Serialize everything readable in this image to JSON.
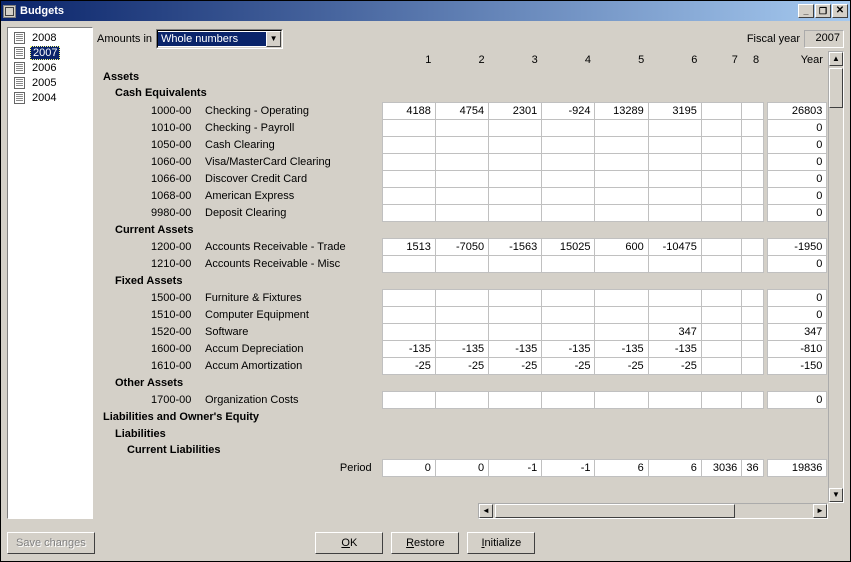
{
  "window": {
    "title": "Budgets"
  },
  "sidebar": {
    "years": [
      {
        "label": "2008",
        "selected": false
      },
      {
        "label": "2007",
        "selected": true
      },
      {
        "label": "2006",
        "selected": false
      },
      {
        "label": "2005",
        "selected": false
      },
      {
        "label": "2004",
        "selected": false
      }
    ]
  },
  "toolbar": {
    "amounts_label": "Amounts in",
    "amounts_value": "Whole numbers",
    "fiscal_year_label": "Fiscal year",
    "fiscal_year_value": "2007"
  },
  "columns": {
    "nums": [
      "1",
      "2",
      "3",
      "4",
      "5",
      "6",
      "7",
      "8"
    ],
    "year_label": "Year"
  },
  "sections": [
    {
      "heading": "Assets",
      "level": 0,
      "groups": [
        {
          "heading": "Cash Equivalents",
          "level": 1,
          "rows": [
            {
              "code": "1000-00",
              "name": "Checking - Operating",
              "vals": [
                "4188",
                "4754",
                "2301",
                "-924",
                "13289",
                "3195",
                "",
                ""
              ],
              "year": "26803"
            },
            {
              "code": "1010-00",
              "name": "Checking - Payroll",
              "vals": [
                "",
                "",
                "",
                "",
                "",
                "",
                "",
                ""
              ],
              "year": "0"
            },
            {
              "code": "1050-00",
              "name": "Cash Clearing",
              "vals": [
                "",
                "",
                "",
                "",
                "",
                "",
                "",
                ""
              ],
              "year": "0"
            },
            {
              "code": "1060-00",
              "name": "Visa/MasterCard Clearing",
              "vals": [
                "",
                "",
                "",
                "",
                "",
                "",
                "",
                ""
              ],
              "year": "0"
            },
            {
              "code": "1066-00",
              "name": "Discover Credit Card",
              "vals": [
                "",
                "",
                "",
                "",
                "",
                "",
                "",
                ""
              ],
              "year": "0"
            },
            {
              "code": "1068-00",
              "name": "American Express",
              "vals": [
                "",
                "",
                "",
                "",
                "",
                "",
                "",
                ""
              ],
              "year": "0"
            },
            {
              "code": "9980-00",
              "name": "Deposit Clearing",
              "vals": [
                "",
                "",
                "",
                "",
                "",
                "",
                "",
                ""
              ],
              "year": "0"
            }
          ]
        },
        {
          "heading": "Current Assets",
          "level": 1,
          "rows": [
            {
              "code": "1200-00",
              "name": "Accounts Receivable - Trade",
              "vals": [
                "1513",
                "-7050",
                "-1563",
                "15025",
                "600",
                "-10475",
                "",
                ""
              ],
              "year": "-1950"
            },
            {
              "code": "1210-00",
              "name": "Accounts Receivable - Misc",
              "vals": [
                "",
                "",
                "",
                "",
                "",
                "",
                "",
                ""
              ],
              "year": "0"
            }
          ]
        },
        {
          "heading": "Fixed Assets",
          "level": 1,
          "rows": [
            {
              "code": "1500-00",
              "name": "Furniture & Fixtures",
              "vals": [
                "",
                "",
                "",
                "",
                "",
                "",
                "",
                ""
              ],
              "year": "0"
            },
            {
              "code": "1510-00",
              "name": "Computer Equipment",
              "vals": [
                "",
                "",
                "",
                "",
                "",
                "",
                "",
                ""
              ],
              "year": "0"
            },
            {
              "code": "1520-00",
              "name": "Software",
              "vals": [
                "",
                "",
                "",
                "",
                "",
                "347",
                "",
                ""
              ],
              "year": "347"
            },
            {
              "code": "1600-00",
              "name": "Accum Depreciation",
              "vals": [
                "-135",
                "-135",
                "-135",
                "-135",
                "-135",
                "-135",
                "",
                ""
              ],
              "year": "-810"
            },
            {
              "code": "1610-00",
              "name": "Accum Amortization",
              "vals": [
                "-25",
                "-25",
                "-25",
                "-25",
                "-25",
                "-25",
                "",
                ""
              ],
              "year": "-150"
            }
          ]
        },
        {
          "heading": "Other Assets",
          "level": 1,
          "rows": [
            {
              "code": "1700-00",
              "name": "Organization Costs",
              "vals": [
                "",
                "",
                "",
                "",
                "",
                "",
                "",
                ""
              ],
              "year": "0"
            }
          ]
        }
      ]
    },
    {
      "heading": "Liabilities and Owner's Equity",
      "level": 0,
      "groups": [
        {
          "heading": "Liabilities",
          "level": 1,
          "groups": [
            {
              "heading": "Current Liabilities",
              "level": 2,
              "rows": []
            }
          ]
        }
      ]
    }
  ],
  "period_row": {
    "label": "Period",
    "vals": [
      "0",
      "0",
      "-1",
      "-1",
      "6",
      "6",
      "3036",
      "36"
    ],
    "year": "19836"
  },
  "footer": {
    "save": "Save changes",
    "ok": "OK",
    "restore": "Restore",
    "initialize": "Initialize"
  }
}
